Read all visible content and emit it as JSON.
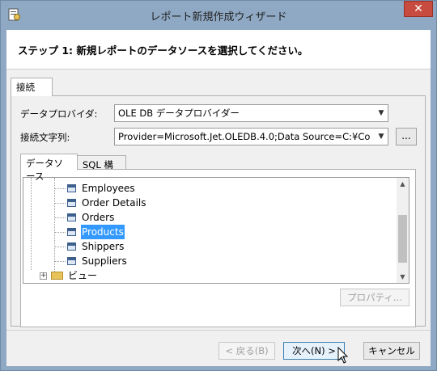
{
  "window": {
    "title": "レポート新規作成ウィザード",
    "close_glyph": "✕"
  },
  "header": {
    "step_text": "ステップ 1: 新規レポートのデータソースを選択してください。"
  },
  "tabs": {
    "connection": "接続"
  },
  "form": {
    "provider_label": "データプロバイダ:",
    "provider_value": "OLE DB データプロバイダー",
    "connstr_label": "接続文字列:",
    "connstr_value": "Provider=Microsoft.Jet.OLEDB.4.0;Data Source=C:¥Co",
    "browse_label": "..."
  },
  "source_tabs": {
    "datasource": "データソース",
    "sql": "SQL 構文"
  },
  "tree": {
    "items": [
      "Employees",
      "Order Details",
      "Orders",
      "Products",
      "Shippers",
      "Suppliers"
    ],
    "selected": "Products",
    "folder": "ビュー"
  },
  "buttons": {
    "properties": "プロパティ...",
    "back": "< 戻る(B)",
    "next": "次へ(N) >",
    "cancel": "キャンセル"
  },
  "colors": {
    "selection": "#3399ff",
    "title_bar": "#8fa9c4",
    "close": "#c74b3f"
  },
  "icons": [
    "app-icon",
    "close-icon",
    "dropdown-arrow-icon",
    "table-icon",
    "folder-icon",
    "expand-icon",
    "mouse-cursor-icon"
  ]
}
